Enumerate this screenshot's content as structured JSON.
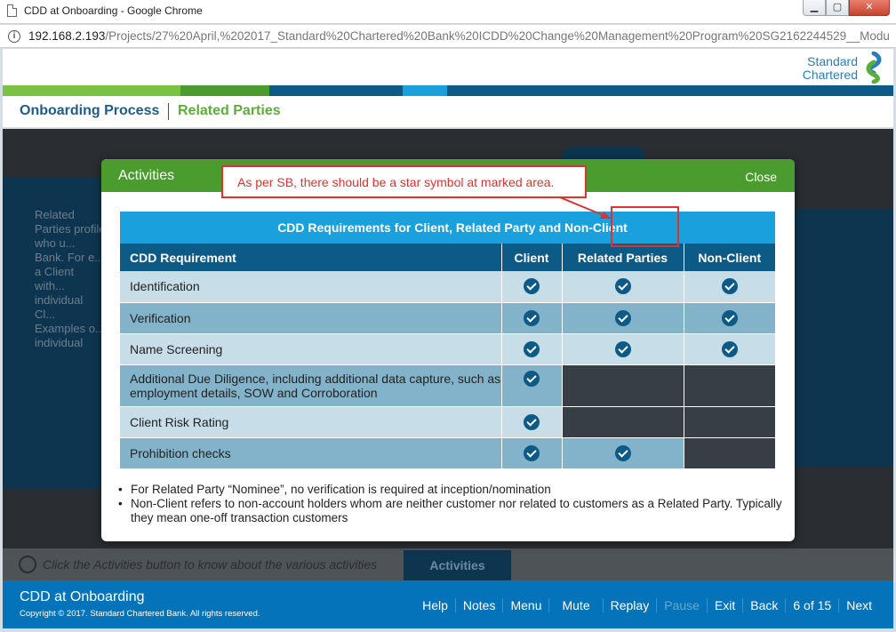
{
  "window": {
    "title": "CDD at Onboarding - Google Chrome",
    "controls": [
      "▁",
      "▢",
      "✕"
    ]
  },
  "address": {
    "host": "192.168.2.193",
    "path": "/Projects/27%20April,%202017_Standard%20Chartered%20Bank%20ICDD%20Change%20Management%20Program%20SG2162244529__Modu"
  },
  "brand": {
    "line1": "Standard",
    "line2": "Chartered"
  },
  "breadcrumb": {
    "section": "Onboarding Process",
    "page": "Related Parties"
  },
  "background_text": "Related Parties profile who u... Bank. For e... a Client with... individual Cl... Examples o... individual gu... supplement...",
  "modal": {
    "title": "Activities",
    "close_label": "Close",
    "table_caption": "CDD Requirements for Client, Related Party and Non-Client",
    "columns": [
      "CDD Requirement",
      "Client",
      "Related Parties",
      "Non-Client"
    ],
    "rows": [
      {
        "label": "Identification",
        "client": true,
        "related": true,
        "nonclient": true
      },
      {
        "label": "Verification",
        "client": true,
        "related": true,
        "nonclient": true
      },
      {
        "label": "Name Screening",
        "client": true,
        "related": true,
        "nonclient": true
      },
      {
        "label": "Additional Due Diligence, including additional data capture, such as employment details, SOW and Corroboration",
        "client": true,
        "related": null,
        "nonclient": null
      },
      {
        "label": "Client Risk Rating",
        "client": true,
        "related": null,
        "nonclient": null
      },
      {
        "label": "Prohibition checks",
        "client": true,
        "related": true,
        "nonclient": null
      }
    ],
    "notes": [
      "For Related Party “Nominee”, no verification is required at inception/nomination",
      "Non-Client refers to non-account holders whom are neither customer nor related to customers as a Related Party. Typically they mean one-off transaction customers"
    ]
  },
  "annotation": {
    "text": "As per SB, there should be a star symbol at marked area.",
    "color": "#e03030"
  },
  "hint": {
    "text": "Click the Activities button to know about the various activities",
    "button": "Activities"
  },
  "footer": {
    "title": "CDD at Onboarding",
    "copyright": "Copyright © 2017. Standard Chartered Bank. All rights reserved.",
    "nav": {
      "help": "Help",
      "notes": "Notes",
      "menu": "Menu",
      "mute": "Mute",
      "replay": "Replay",
      "pause": "Pause",
      "exit": "Exit",
      "back": "Back",
      "page": "6 of 15",
      "next": "Next"
    }
  },
  "colors": {
    "green": "#4a9c2e",
    "blue": "#0473b9",
    "navy": "#0e5a86",
    "cyan": "#1aa0dc"
  }
}
